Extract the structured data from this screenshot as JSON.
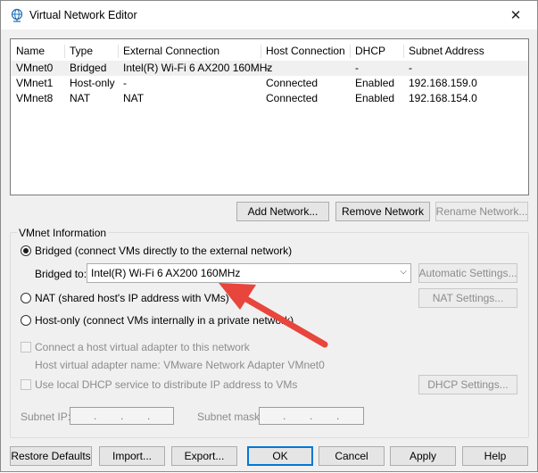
{
  "window": {
    "title": "Virtual Network Editor",
    "close": "✕"
  },
  "table": {
    "headers": [
      "Name",
      "Type",
      "External Connection",
      "Host Connection",
      "DHCP",
      "Subnet Address"
    ],
    "rows": [
      [
        "VMnet0",
        "Bridged",
        "Intel(R) Wi-Fi 6 AX200 160MHz",
        "-",
        "-",
        "-"
      ],
      [
        "VMnet1",
        "Host-only",
        "-",
        "Connected",
        "Enabled",
        "192.168.159.0"
      ],
      [
        "VMnet8",
        "NAT",
        "NAT",
        "Connected",
        "Enabled",
        "192.168.154.0"
      ]
    ]
  },
  "table_buttons": {
    "add": "Add Network...",
    "remove": "Remove Network",
    "rename": "Rename Network..."
  },
  "vmnet_info": {
    "title": "VMnet Information",
    "bridged_label": "Bridged (connect VMs directly to the external network)",
    "bridged_to_label": "Bridged to:",
    "bridged_to_value": "Intel(R) Wi-Fi 6 AX200 160MHz",
    "automatic_settings": "Automatic Settings...",
    "nat_label": "NAT (shared host's IP address with VMs)",
    "nat_settings": "NAT Settings...",
    "hostonly_label": "Host-only (connect VMs internally in a private network)",
    "connect_adapter_label": "Connect a host virtual adapter to this network",
    "adapter_name_label": "Host virtual adapter name: VMware Network Adapter VMnet0",
    "dhcp_label": "Use local DHCP service to distribute IP address to VMs",
    "dhcp_settings": "DHCP Settings...",
    "subnet_ip_label": "Subnet IP:",
    "subnet_mask_label": "Subnet mask:",
    "selected": "bridged"
  },
  "bottom_buttons": {
    "restore": "Restore Defaults",
    "import": "Import...",
    "export": "Export...",
    "ok": "OK",
    "cancel": "Cancel",
    "apply": "Apply",
    "help": "Help"
  },
  "colors": {
    "annotation_arrow": "#e8453c",
    "focus_border": "#0078d7"
  }
}
